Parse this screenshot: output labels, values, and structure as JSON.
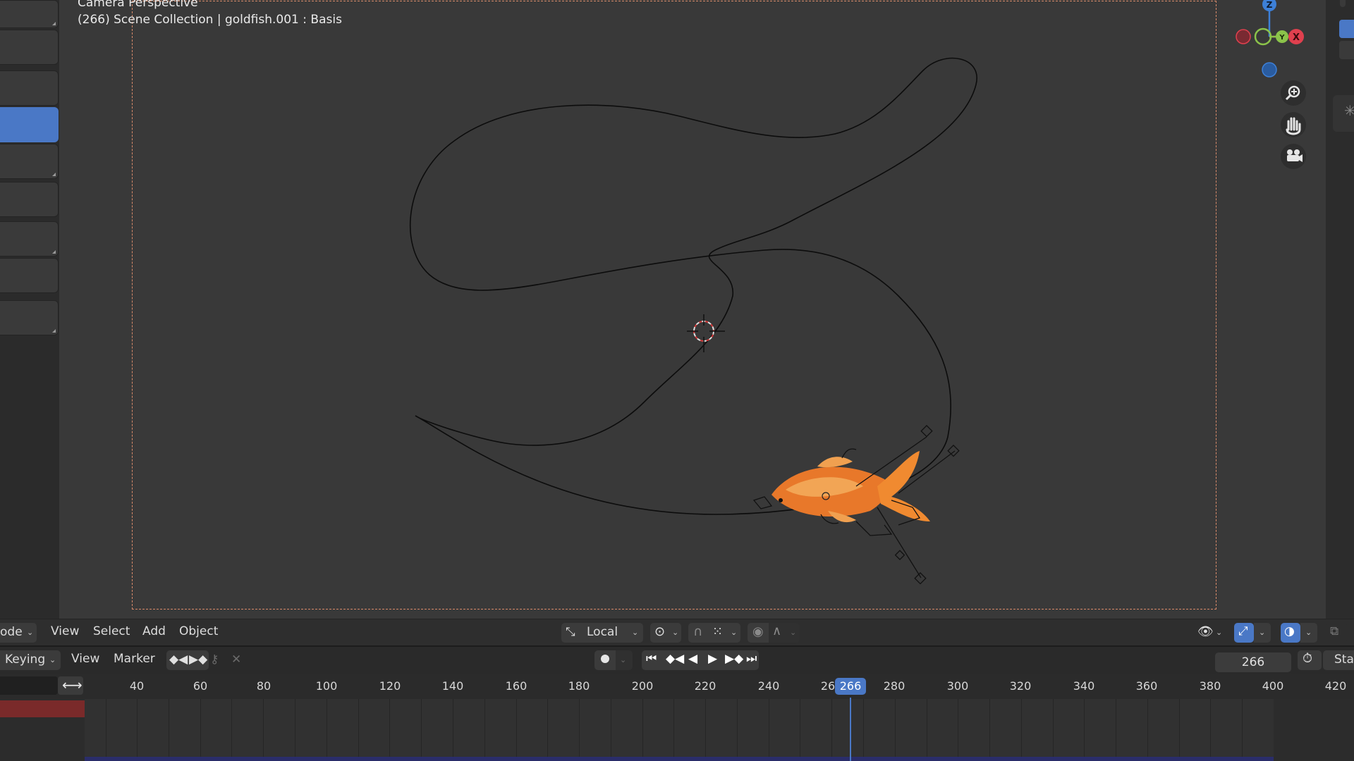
{
  "viewport": {
    "title": "Camera Perspective",
    "collection_info": "(266) Scene Collection | goldfish.001 : Basis"
  },
  "header": {
    "mode": "ode",
    "menus": [
      "View",
      "Select",
      "Add",
      "Object"
    ],
    "transform_orientation": "Local"
  },
  "timeline": {
    "keying": "Keying",
    "menus": [
      "View",
      "Marker"
    ],
    "current_frame": "266",
    "start_label": "Star",
    "ruler_labels": [
      "40",
      "60",
      "80",
      "100",
      "120",
      "140",
      "160",
      "180",
      "200",
      "220",
      "240",
      "26",
      "280",
      "300",
      "320",
      "340",
      "360",
      "380",
      "400",
      "420"
    ],
    "playhead_label": "266"
  },
  "gizmo": {
    "x_label": "X",
    "z_label": "Z",
    "y_label": "Y"
  },
  "colors": {
    "accent": "#4a78c6",
    "x_axis": "#e0404e",
    "y_axis": "#8bc34a",
    "z_axis": "#3d80d8",
    "frame_border": "#d88a6a"
  }
}
